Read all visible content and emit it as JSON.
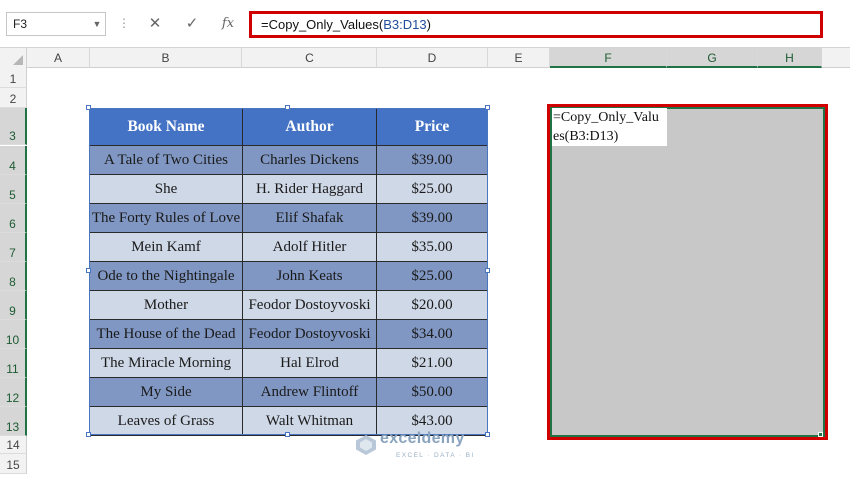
{
  "name_box": "F3",
  "formula_bar": {
    "text_prefix": "=Copy_Only_Values(",
    "text_ref": "B3:D13",
    "text_suffix": ")",
    "cancel_icon": "x-icon",
    "enter_icon": "check-icon",
    "function_icon": "fx"
  },
  "columns": [
    "A",
    "B",
    "C",
    "D",
    "E",
    "F",
    "G",
    "H"
  ],
  "selected_columns": [
    "F",
    "G",
    "H"
  ],
  "rows": [
    "1",
    "2",
    "3",
    "4",
    "5",
    "6",
    "7",
    "8",
    "9",
    "10",
    "11",
    "12",
    "13",
    "14",
    "15"
  ],
  "selected_rows": [
    "3",
    "4",
    "5",
    "6",
    "7",
    "8",
    "9",
    "10",
    "11",
    "12",
    "13"
  ],
  "table": {
    "headers": [
      "Book Name",
      "Author",
      "Price"
    ],
    "rows": [
      [
        "A Tale of Two Cities",
        "Charles Dickens",
        "$39.00"
      ],
      [
        "She",
        "H. Rider Haggard",
        "$25.00"
      ],
      [
        "The Forty Rules of Love",
        "Elif Shafak",
        "$39.00"
      ],
      [
        "Mein Kamf",
        "Adolf Hitler",
        "$35.00"
      ],
      [
        "Ode to the Nightingale",
        "John Keats",
        "$25.00"
      ],
      [
        "Mother",
        "Feodor Dostoyvoski",
        "$20.00"
      ],
      [
        "The House of the Dead",
        "Feodor Dostoyvoski",
        "$34.00"
      ],
      [
        "The Miracle Morning",
        "Hal Elrod",
        "$21.00"
      ],
      [
        "My Side",
        "Andrew Flintoff",
        "$50.00"
      ],
      [
        "Leaves of Grass",
        "Walt Whitman",
        "$43.00"
      ]
    ]
  },
  "output_cell_text_line1": "=Copy_Only_Valu",
  "output_cell_text_line2": "es(B3:D13)",
  "watermark": {
    "name": "exceldemy",
    "tagline": "EXCEL · DATA · BI"
  },
  "colors": {
    "header_blue": "#4472c4",
    "row_dark": "#8097c3",
    "row_light": "#cfd8e7",
    "highlight_red": "#d10000",
    "selection_green": "#217346"
  }
}
